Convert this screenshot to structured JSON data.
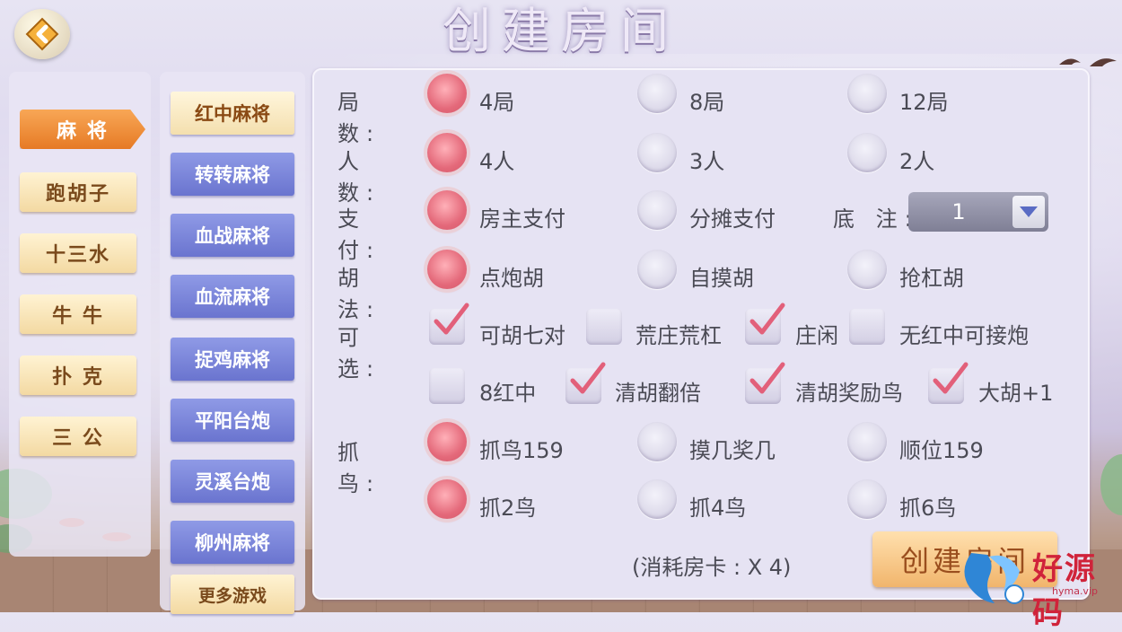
{
  "header": {
    "title": "创建房间",
    "back_icon": "back-arrow-icon"
  },
  "categories": [
    {
      "label": "麻 将",
      "active": true
    },
    {
      "label": "跑胡子",
      "active": false
    },
    {
      "label": "十三水",
      "active": false
    },
    {
      "label": "牛 牛",
      "active": false
    },
    {
      "label": "扑 克",
      "active": false
    },
    {
      "label": "三 公",
      "active": false
    }
  ],
  "games": [
    {
      "label": "红中麻将",
      "active": true
    },
    {
      "label": "转转麻将",
      "active": false
    },
    {
      "label": "血战麻将",
      "active": false
    },
    {
      "label": "血流麻将",
      "active": false
    },
    {
      "label": "捉鸡麻将",
      "active": false
    },
    {
      "label": "平阳台炮",
      "active": false
    },
    {
      "label": "灵溪台炮",
      "active": false
    },
    {
      "label": "柳州麻将",
      "active": false
    }
  ],
  "more_games_label": "更多游戏",
  "options": {
    "rounds": {
      "label": "局  数:",
      "choices": [
        "4局",
        "8局",
        "12局"
      ],
      "selected": "4局"
    },
    "players": {
      "label": "人  数:",
      "choices": [
        "4人",
        "3人",
        "2人"
      ],
      "selected": "4人"
    },
    "payment": {
      "label": "支  付:",
      "choices": [
        "房主支付",
        "分摊支付"
      ],
      "selected": "房主支付"
    },
    "base_bet": {
      "label": "底  注:",
      "value": "1"
    },
    "hu_method": {
      "label": "胡  法:",
      "choices": [
        "点炮胡",
        "自摸胡",
        "抢杠胡"
      ],
      "selected": "点炮胡"
    },
    "optional": {
      "label": "可  选:",
      "items": [
        {
          "label": "可胡七对",
          "checked": true
        },
        {
          "label": "荒庄荒杠",
          "checked": false
        },
        {
          "label": "庄闲",
          "checked": true
        },
        {
          "label": "无红中可接炮",
          "checked": false
        },
        {
          "label": "8红中",
          "checked": false
        },
        {
          "label": "清胡翻倍",
          "checked": true
        },
        {
          "label": "清胡奖励鸟",
          "checked": true
        },
        {
          "label": "大胡+1",
          "checked": true
        }
      ]
    },
    "bird_mode": {
      "label": "抓  鸟:",
      "choices": [
        "抓鸟159",
        "摸几奖几",
        "顺位159"
      ],
      "selected": "抓鸟159"
    },
    "bird_count": {
      "choices": [
        "抓2鸟",
        "抓4鸟",
        "抓6鸟"
      ],
      "selected": "抓2鸟"
    }
  },
  "cost_text": "(消耗房卡 : X 4)",
  "create_button_label": "创建房间",
  "watermark": {
    "text": "好源码",
    "url": "hyma.vip"
  },
  "colors": {
    "accent_orange": "#e67a25",
    "game_blue": "#6a74cf",
    "radio_on": "#e4697a"
  }
}
